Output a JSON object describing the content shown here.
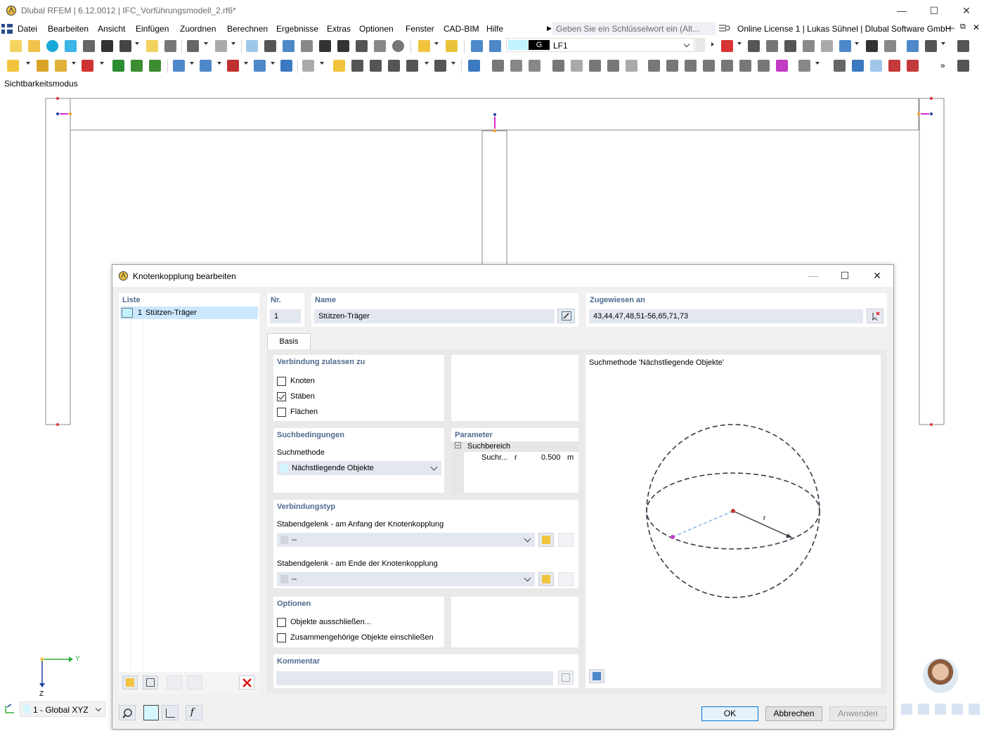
{
  "app": {
    "title": "Dlubal RFEM | 6.12.0012 | IFC_Vorführungsmodell_2.rf6*",
    "license": "Online License 1 | Lukas Sühnel | Dlubal Software GmbH",
    "search_placeholder": "Geben Sie ein Schlüsselwort ein (Alt...",
    "visibility_mode": "Sichtbarkeitsmodus"
  },
  "menu": [
    "Datei",
    "Bearbeiten",
    "Ansicht",
    "Einfügen",
    "Zuordnen",
    "Berechnen",
    "Ergebnisse",
    "Extras",
    "Optionen",
    "Fenster",
    "CAD-BIM",
    "Hilfe"
  ],
  "load_case": {
    "badge": "G",
    "name": "LF1"
  },
  "coordinate_system": "1 - Global XYZ",
  "axes": {
    "y": "Y",
    "z": "Z"
  },
  "dialog": {
    "title": "Knotenkopplung bearbeiten",
    "list": {
      "heading": "Liste",
      "items": [
        {
          "nr": "1",
          "name": "Stützen-Träger"
        }
      ]
    },
    "nr": {
      "label": "Nr.",
      "value": "1"
    },
    "name": {
      "label": "Name",
      "value": "Stützen-Träger"
    },
    "assigned": {
      "label": "Zugewiesen an",
      "value": "43,44,47,48,51-56,65,71,73"
    },
    "tab": "Basis",
    "connection_allowed": {
      "heading": "Verbindung zulassen zu",
      "options": [
        {
          "label": "Knoten",
          "checked": false
        },
        {
          "label": "Stäben",
          "checked": true
        },
        {
          "label": "Flächen",
          "checked": false
        }
      ]
    },
    "search": {
      "heading": "Suchbedingungen",
      "method_label": "Suchmethode",
      "method_value": "Nächstliegende Objekte"
    },
    "parameters": {
      "heading": "Parameter",
      "group": "Suchbereich",
      "row_name": "Suchr...",
      "row_symbol": "r",
      "row_value": "0.500",
      "row_unit": "m"
    },
    "connection_type": {
      "heading": "Verbindungstyp",
      "start_label": "Stabendgelenk - am Anfang der Knotenkopplung",
      "start_value": "--",
      "end_label": "Stabendgelenk - am Ende der Knotenkopplung",
      "end_value": "--"
    },
    "options": {
      "heading": "Optionen",
      "items": [
        {
          "label": "Objekte ausschließen...",
          "checked": false
        },
        {
          "label": "Zusammengehörige Objekte einschließen",
          "checked": false
        }
      ]
    },
    "comment": {
      "heading": "Kommentar",
      "value": ""
    },
    "preview": {
      "title": "Suchmethode 'Nächstliegende Objekte'",
      "radius_label": "r"
    },
    "buttons": {
      "ok": "OK",
      "cancel": "Abbrechen",
      "apply": "Anwenden"
    }
  },
  "colors": {
    "accent": "#4e6b8e",
    "selection": "#cce8ff",
    "swatch": "#bff3ff",
    "delete": "#e01010"
  }
}
